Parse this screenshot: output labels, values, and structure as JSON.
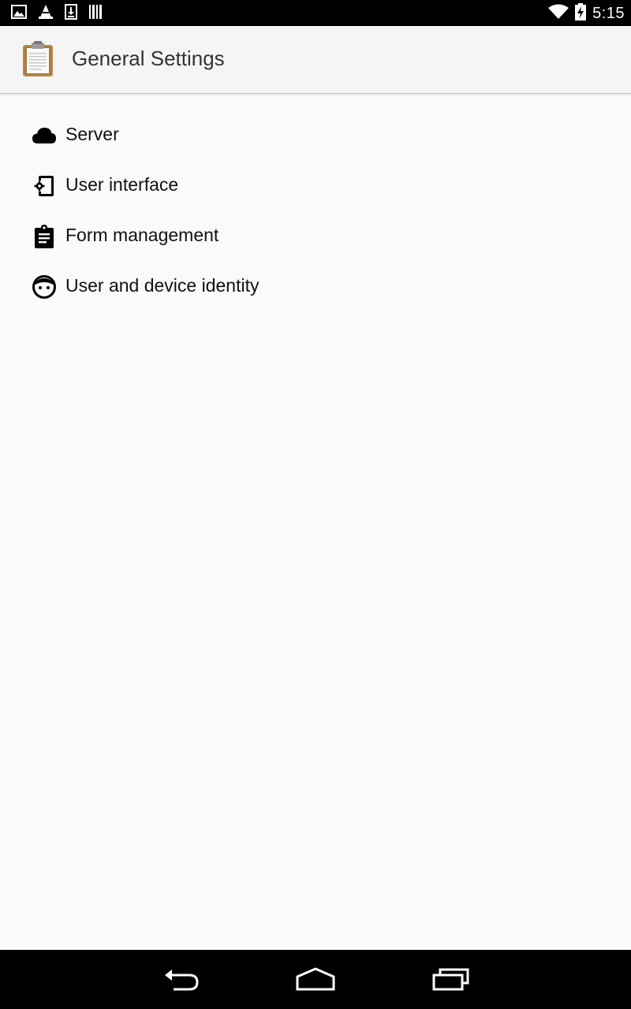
{
  "status_bar": {
    "time": "5:15",
    "left_icons": [
      "image-notification-icon",
      "vlc-cone-icon",
      "download-notification-icon",
      "barcode-icon"
    ],
    "right_icons": [
      "wifi-icon",
      "battery-charging-icon"
    ]
  },
  "app_bar": {
    "title": "General Settings",
    "icon": "clipboard-app-icon"
  },
  "settings": {
    "items": [
      {
        "label": "Server",
        "icon": "cloud-icon"
      },
      {
        "label": "User interface",
        "icon": "phone-settings-icon"
      },
      {
        "label": "Form management",
        "icon": "clipboard-icon"
      },
      {
        "label": "User and device identity",
        "icon": "face-icon"
      }
    ]
  },
  "nav_bar": {
    "buttons": [
      "back-button",
      "home-button",
      "recent-apps-button"
    ]
  }
}
